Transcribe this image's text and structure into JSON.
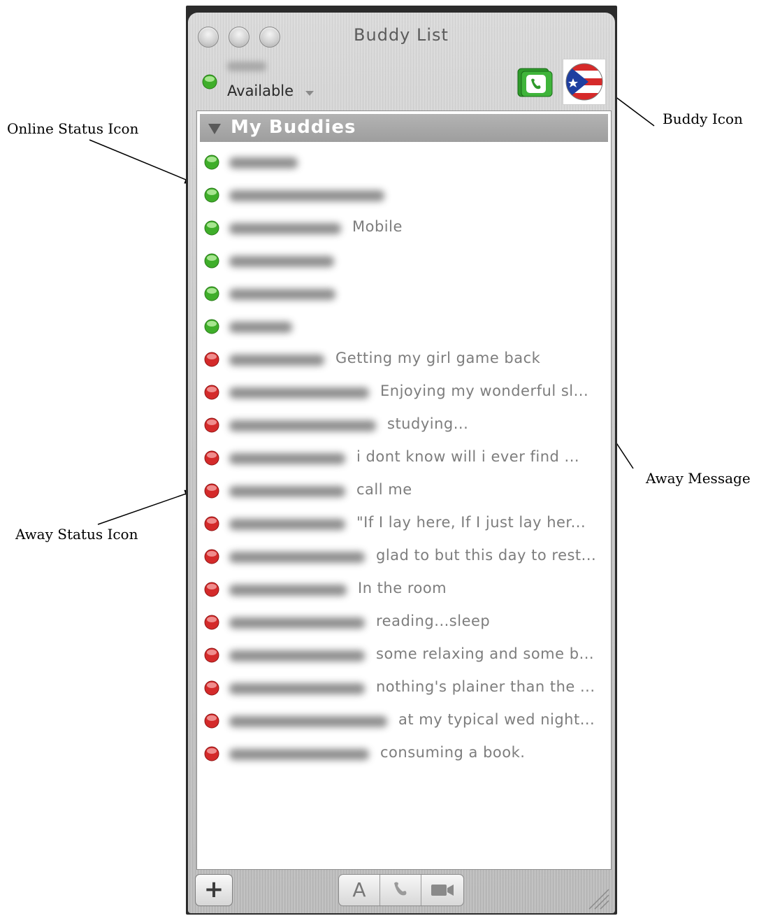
{
  "window": {
    "title": "Buddy List",
    "self_status": "Available"
  },
  "group": {
    "label": "My Buddies"
  },
  "buddies": [
    {
      "status": "online",
      "message": ""
    },
    {
      "status": "online",
      "message": ""
    },
    {
      "status": "online",
      "message": "Mobile"
    },
    {
      "status": "online",
      "message": ""
    },
    {
      "status": "online",
      "message": ""
    },
    {
      "status": "online",
      "message": ""
    },
    {
      "status": "away",
      "message": "Getting my girl game back"
    },
    {
      "status": "away",
      "message": "Enjoying my wonderful sl..."
    },
    {
      "status": "away",
      "message": "studying..."
    },
    {
      "status": "away",
      "message": "i dont know  will i ever find ..."
    },
    {
      "status": "away",
      "message": "call me"
    },
    {
      "status": "away",
      "message": "\"If I lay here,  If I just lay her..."
    },
    {
      "status": "away",
      "message": "glad to but this day to rest..."
    },
    {
      "status": "away",
      "message": "In the room"
    },
    {
      "status": "away",
      "message": "reading...sleep"
    },
    {
      "status": "away",
      "message": "some relaxing and some b..."
    },
    {
      "status": "away",
      "message": "nothing's plainer than the ..."
    },
    {
      "status": "away",
      "message": "at my typical wed night..."
    },
    {
      "status": "away",
      "message": "consuming a book."
    }
  ],
  "toolbar": {
    "add_label": "+",
    "text_label": "A"
  },
  "annotations": {
    "online_status_icon": "Online Status Icon",
    "away_status_icon": "Away  Status Icon",
    "buddy_icon": "Buddy Icon",
    "away_message": "Away Message"
  },
  "colors": {
    "online": "#3fae2a",
    "away": "#d42a2a"
  }
}
